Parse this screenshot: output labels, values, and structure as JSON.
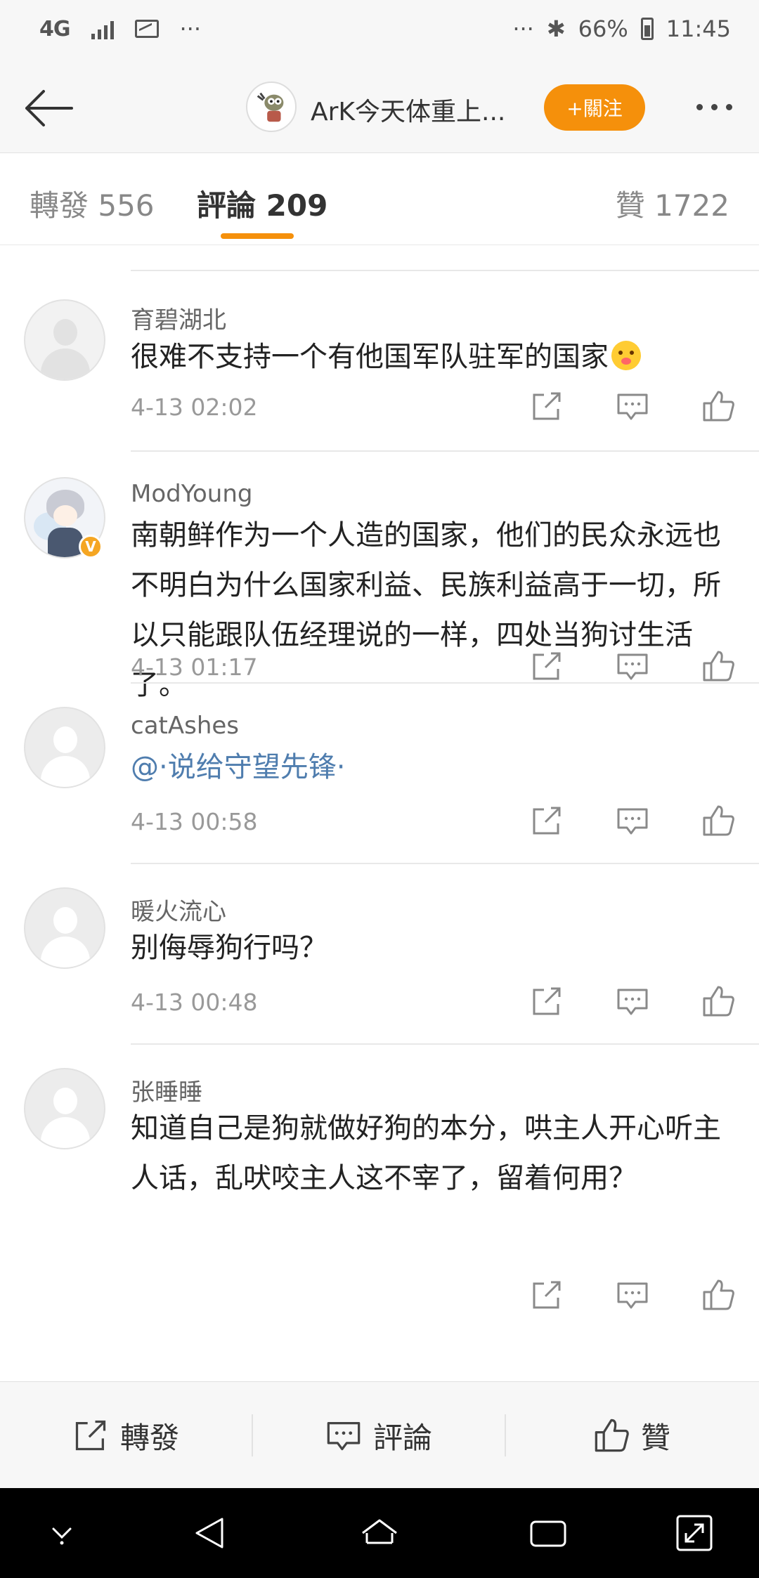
{
  "status_bar": {
    "network": "4G",
    "dots_left": "···",
    "dots_right": "···",
    "bluetooth": "✱",
    "battery_text": "66%",
    "time": "11:45"
  },
  "header": {
    "title": "ArK今天体重上...",
    "follow_label": "+關注"
  },
  "tabs": {
    "repost": "轉發 556",
    "comments": "評論 209",
    "likes": "贊 1722"
  },
  "comments": [
    {
      "name": "育碧湖北",
      "text": "很难不支持一个有他国军队驻军的国家",
      "time": "4-13 02:02",
      "avatar_icon": "default-avatar-icon"
    },
    {
      "name": "ModYoung",
      "text": "南朝鲜作为一个人造的国家，他们的民众永远也不明白为什么国家利益、民族利益高于一切，所以只能跟队伍经理说的一样，四处当狗讨生活了。",
      "time": "4-13 01:17",
      "avatar_icon": "anime-avatar-icon",
      "verified_badge": "V"
    },
    {
      "name": "catAshes",
      "text": "@·说给守望先锋·",
      "time": "4-13 00:58",
      "avatar_icon": "default-avatar-icon"
    },
    {
      "name": "暖火流心",
      "text": "别侮辱狗行吗？",
      "time": "4-13 00:48",
      "avatar_icon": "default-avatar-icon"
    },
    {
      "name": "张睡睡",
      "text": "知道自己是狗就做好狗的本分，哄主人开心听主人话，乱吠咬主人这不宰了，留着何用？",
      "time": "",
      "avatar_icon": "default-avatar-icon"
    }
  ],
  "bottom_bar": {
    "repost": "轉發",
    "comment": "評論",
    "like": "贊"
  },
  "colors": {
    "accent": "#f5900b",
    "mention": "#4f7dae",
    "background": "#ffffff",
    "bar_background": "#f7f7f7"
  }
}
